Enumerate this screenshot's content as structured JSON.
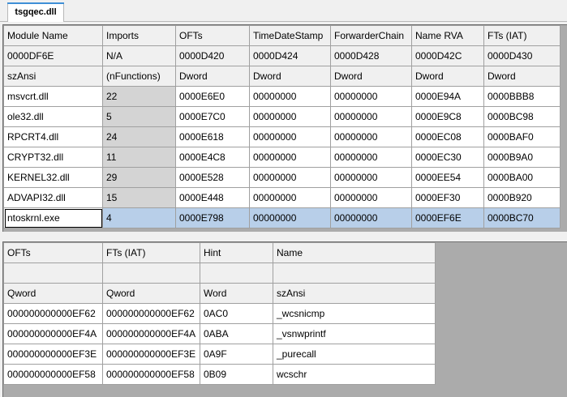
{
  "tab": {
    "label": "tsgqec.dll"
  },
  "imports_table": {
    "columns": [
      "Module Name",
      "Imports",
      "OFTs",
      "TimeDateStamp",
      "ForwarderChain",
      "Name RVA",
      "FTs (IAT)"
    ],
    "offsets": [
      "0000DF6E",
      "N/A",
      "0000D420",
      "0000D424",
      "0000D428",
      "0000D42C",
      "0000D430"
    ],
    "types": [
      "szAnsi",
      "(nFunctions)",
      "Dword",
      "Dword",
      "Dword",
      "Dword",
      "Dword"
    ],
    "rows": [
      [
        "msvcrt.dll",
        "22",
        "0000E6E0",
        "00000000",
        "00000000",
        "0000E94A",
        "0000BBB8"
      ],
      [
        "ole32.dll",
        "5",
        "0000E7C0",
        "00000000",
        "00000000",
        "0000E9C8",
        "0000BC98"
      ],
      [
        "RPCRT4.dll",
        "24",
        "0000E618",
        "00000000",
        "00000000",
        "0000EC08",
        "0000BAF0"
      ],
      [
        "CRYPT32.dll",
        "11",
        "0000E4C8",
        "00000000",
        "00000000",
        "0000EC30",
        "0000B9A0"
      ],
      [
        "KERNEL32.dll",
        "29",
        "0000E528",
        "00000000",
        "00000000",
        "0000EE54",
        "0000BA00"
      ],
      [
        "ADVAPI32.dll",
        "15",
        "0000E448",
        "00000000",
        "00000000",
        "0000EF30",
        "0000B920"
      ],
      [
        "ntoskrnl.exe",
        "4",
        "0000E798",
        "00000000",
        "00000000",
        "0000EF6E",
        "0000BC70"
      ]
    ],
    "selected_row": 6
  },
  "functions_table": {
    "columns": [
      "OFTs",
      "FTs (IAT)",
      "Hint",
      "Name"
    ],
    "offsets": [
      "",
      "",
      "",
      ""
    ],
    "types": [
      "Qword",
      "Qword",
      "Word",
      "szAnsi"
    ],
    "rows": [
      [
        "000000000000EF62",
        "000000000000EF62",
        "0AC0",
        "_wcsnicmp"
      ],
      [
        "000000000000EF4A",
        "000000000000EF4A",
        "0ABA",
        "_vsnwprintf"
      ],
      [
        "000000000000EF3E",
        "000000000000EF3E",
        "0A9F",
        "_purecall"
      ],
      [
        "000000000000EF58",
        "000000000000EF58",
        "0B09",
        "wcschr"
      ]
    ]
  }
}
